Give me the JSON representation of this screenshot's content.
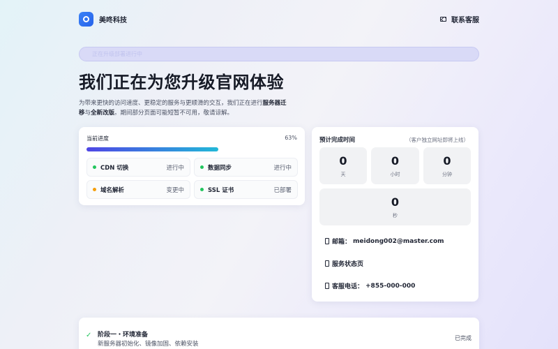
{
  "header": {
    "brand": "美咚科技",
    "contact": "联系客服"
  },
  "banner": {
    "pill_text": "正在升级部署进行中",
    "headline": "我们正在为您升级官网体验",
    "desc_part1": "为带来更快的访问速度、更稳定的服务与更顺滑的交互，我们正在进行",
    "desc_bold1": "服务器迁移",
    "desc_part2": "与",
    "desc_bold2": "全新改版",
    "desc_part3": "。期间部分页面可能短暂不可用，敬请谅解。"
  },
  "progress": {
    "title": "当前进度",
    "percent_label": "63%",
    "value": 0.63,
    "tasks": [
      {
        "name": "CDN 切换",
        "status": "进行中",
        "color": "#22c55e"
      },
      {
        "name": "数据同步",
        "status": "进行中",
        "color": "#22c55e"
      },
      {
        "name": "域名解析",
        "status": "变更中",
        "color": "#f59e0b"
      },
      {
        "name": "SSL 证书",
        "status": "已部署",
        "color": "#22c55e"
      }
    ]
  },
  "countdown": {
    "title": "预计完成时间",
    "note": "（客户独立网址即将上线）",
    "days": "0",
    "days_label": "天",
    "hours": "0",
    "hours_label": "小时",
    "minutes": "0",
    "minutes_label": "分钟",
    "seconds": "0",
    "seconds_label": "秒"
  },
  "contact_info": {
    "email_label": "邮箱：",
    "email": "meidong002@master.com",
    "status_page": "服务状态页",
    "phone_label": "客服电话：",
    "phone": "+855-000-000"
  },
  "phase": {
    "title": "阶段一・环境准备",
    "subtitle": "新服务器初始化、镜像加固、依赖安装",
    "status": "已完成"
  }
}
